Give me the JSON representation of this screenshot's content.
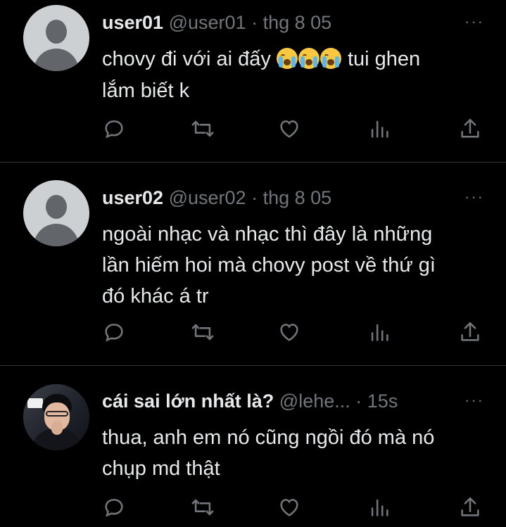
{
  "tweets": [
    {
      "name": "user01",
      "handle": "@user01",
      "separator": "·",
      "time": "thg 8 05",
      "text_line1_start": "chovy đi với ai đấy ",
      "emojis": [
        "loudly-crying-face",
        "loudly-crying-face",
        "loudly-crying-face"
      ],
      "text_line1_end": " tui ghen",
      "text_line2": "lắm biết k",
      "avatar": "default-avatar"
    },
    {
      "name": "user02",
      "handle": "@user02",
      "separator": "·",
      "time": "thg 8 05",
      "text_lines": [
        "ngoài nhạc và nhạc thì đây là những",
        "lần hiếm hoi mà chovy post về thứ gì",
        "đó khác á tr"
      ],
      "avatar": "default-avatar"
    },
    {
      "name": "cái sai lớn nhất là?",
      "handle": "@lehe...",
      "separator": "·",
      "time": "15s",
      "text_lines": [
        "thua, anh em nó cũng ngồi đó mà nó",
        "chụp md thật"
      ],
      "avatar": "photo-avatar"
    }
  ],
  "more_label": "···",
  "action_icons": [
    "reply-icon",
    "retweet-icon",
    "like-icon",
    "views-icon",
    "share-icon"
  ],
  "colors": {
    "background": "#000000",
    "text": "#e7e9ea",
    "muted": "#71767b",
    "divider": "#2f3336"
  }
}
